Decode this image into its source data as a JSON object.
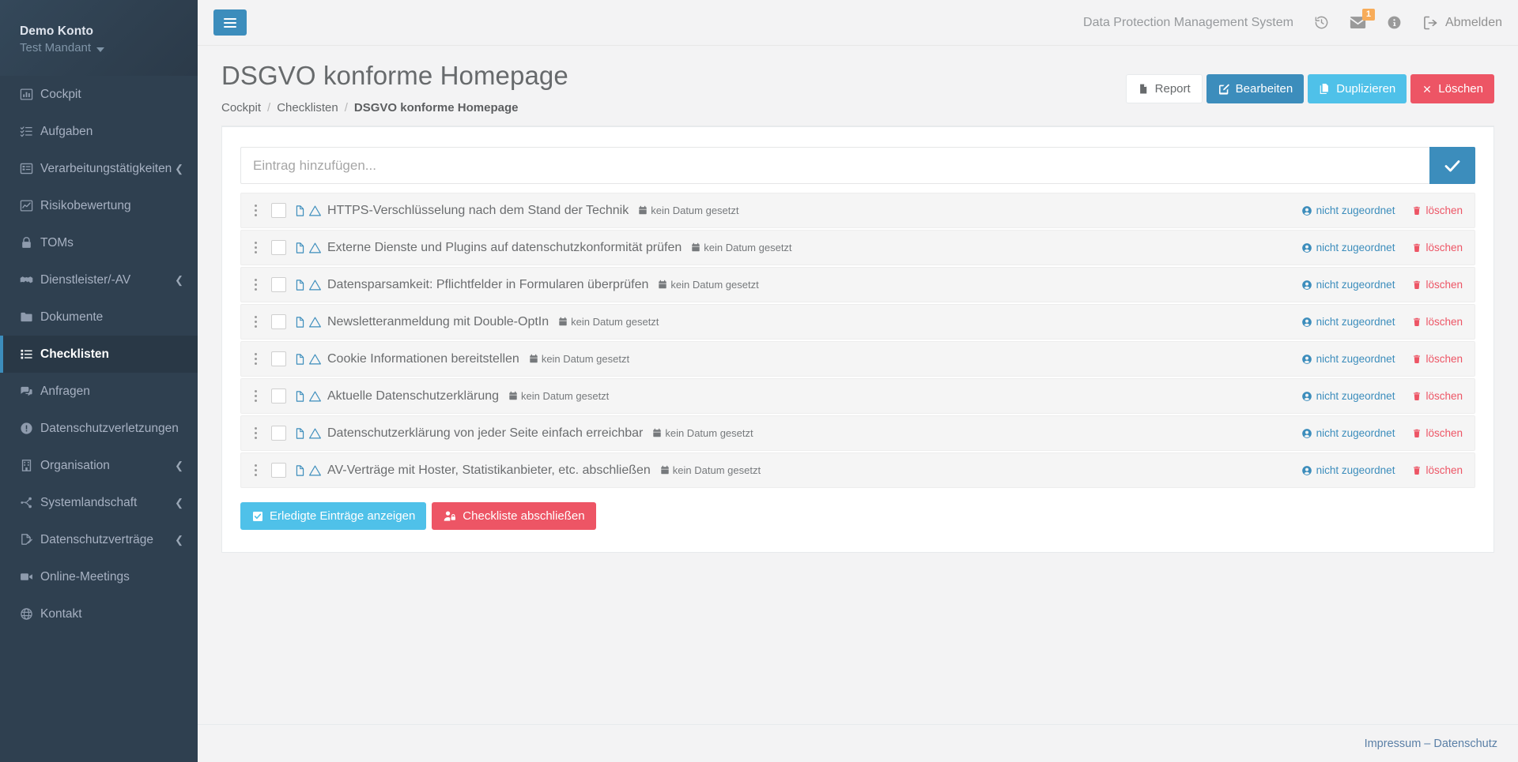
{
  "sidebar": {
    "profile": {
      "name": "Demo Konto",
      "tenant": "Test Mandant"
    },
    "items": [
      {
        "label": "Cockpit",
        "icon": "chart-bar-icon",
        "expandable": false,
        "active": false
      },
      {
        "label": "Aufgaben",
        "icon": "tasks-list-icon",
        "expandable": false,
        "active": false
      },
      {
        "label": "Verarbeitungstätigkeiten",
        "icon": "table-list-icon",
        "expandable": true,
        "active": false
      },
      {
        "label": "Risikobewertung",
        "icon": "chart-line-icon",
        "expandable": false,
        "active": false
      },
      {
        "label": "TOMs",
        "icon": "lock-icon",
        "expandable": false,
        "active": false
      },
      {
        "label": "Dienstleister/-AV",
        "icon": "handshake-icon",
        "expandable": true,
        "active": false
      },
      {
        "label": "Dokumente",
        "icon": "folder-icon",
        "expandable": false,
        "active": false
      },
      {
        "label": "Checklisten",
        "icon": "list-check-icon",
        "expandable": false,
        "active": true
      },
      {
        "label": "Anfragen",
        "icon": "comments-icon",
        "expandable": false,
        "active": false
      },
      {
        "label": "Datenschutzverletzungen",
        "icon": "exclamation-circle-icon",
        "expandable": false,
        "active": false
      },
      {
        "label": "Organisation",
        "icon": "building-icon",
        "expandable": true,
        "active": false
      },
      {
        "label": "Systemlandschaft",
        "icon": "network-nodes-icon",
        "expandable": true,
        "active": false
      },
      {
        "label": "Datenschutzverträge",
        "icon": "file-signature-icon",
        "expandable": true,
        "active": false
      },
      {
        "label": "Online-Meetings",
        "icon": "video-camera-icon",
        "expandable": false,
        "active": false
      },
      {
        "label": "Kontakt",
        "icon": "globe-icon",
        "expandable": false,
        "active": false
      }
    ]
  },
  "topbar": {
    "menu_toggle_icon": "hamburger-icon",
    "brand": "Data Protection Management System",
    "history_icon": "history-clock-icon",
    "mail_icon": "envelope-icon",
    "mail_badge": "1",
    "info_icon": "info-circle-icon",
    "logout_icon": "sign-out-icon",
    "logout_label": "Abmelden"
  },
  "page": {
    "title": "DSGVO konforme Homepage",
    "breadcrumb": [
      {
        "label": "Cockpit",
        "active": false
      },
      {
        "label": "Checklisten",
        "active": false
      },
      {
        "label": "DSGVO konforme Homepage",
        "active": true
      }
    ],
    "actions": [
      {
        "label": "Report",
        "icon": "file-pdf-icon",
        "style": "btn-white"
      },
      {
        "label": "Bearbeiten",
        "icon": "pencil-square-icon",
        "style": "btn-primary"
      },
      {
        "label": "Duplizieren",
        "icon": "copy-icon",
        "style": "btn-info"
      },
      {
        "label": "Löschen",
        "icon": "times-icon",
        "style": "btn-danger"
      }
    ]
  },
  "checklist": {
    "add_placeholder": "Eintrag hinzufügen...",
    "add_value": "",
    "add_submit_icon": "check-icon",
    "row_icons": {
      "drag": "drag-dots-icon",
      "doc": "file-document-icon",
      "warn": "warning-triangle-icon",
      "date": "calendar-icon",
      "assign": "user-circle-icon",
      "delete": "trash-icon"
    },
    "no_date_label": "kein Datum gesetzt",
    "assign_label": "nicht zugeordnet",
    "delete_label": "löschen",
    "items": [
      {
        "text": "HTTPS-Verschlüsselung nach dem Stand der Technik",
        "checked": false
      },
      {
        "text": "Externe Dienste und Plugins auf datenschutzkonformität prüfen",
        "checked": false
      },
      {
        "text": "Datensparsamkeit: Pflichtfelder in Formularen überprüfen",
        "checked": false
      },
      {
        "text": "Newsletteranmeldung mit Double-OptIn",
        "checked": false
      },
      {
        "text": "Cookie Informationen bereitstellen",
        "checked": false
      },
      {
        "text": "Aktuelle Datenschutzerklärung",
        "checked": false
      },
      {
        "text": "Datenschutzerklärung von jeder Seite einfach erreichbar",
        "checked": false
      },
      {
        "text": "AV-Verträge mit Hoster, Statistikanbieter, etc. abschließen",
        "checked": false
      }
    ],
    "footer_actions": [
      {
        "label": "Erledigte Einträge anzeigen",
        "icon": "check-square-icon",
        "style": "btn-info"
      },
      {
        "label": "Checkliste abschließen",
        "icon": "user-lock-icon",
        "style": "btn-danger"
      }
    ]
  },
  "footer": {
    "links": "Impressum – Datenschutz"
  },
  "colors": {
    "sidebar_bg": "#2f4050",
    "sidebar_active_bg": "#293846",
    "accent_blue": "#3c8dbc",
    "info_cyan": "#4fc1e9",
    "danger_red": "#ed5565",
    "badge_orange": "#f8ac59",
    "page_bg": "#f3f3f4",
    "text_grey": "#676a6c"
  }
}
